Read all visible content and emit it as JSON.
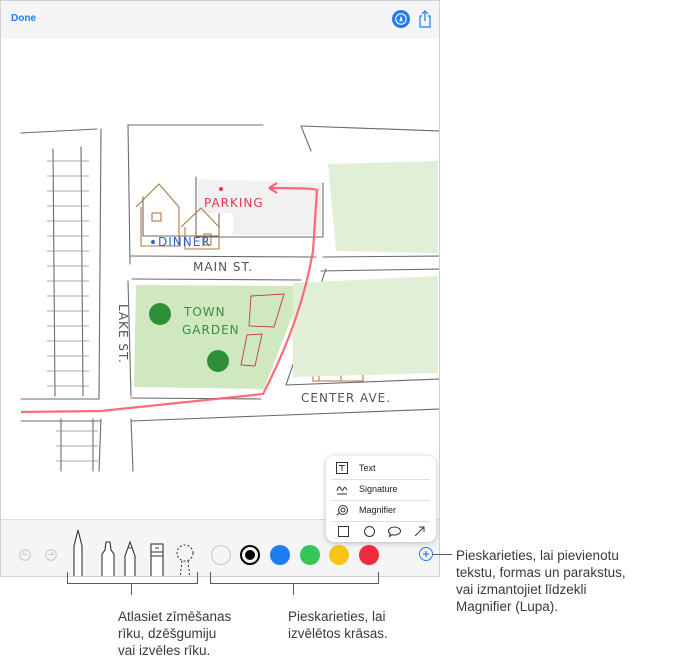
{
  "topbar": {
    "done_label": "Done",
    "markup_icon": "markup-pen-icon",
    "share_icon": "share-icon"
  },
  "map": {
    "labels": {
      "parking": "PARKING",
      "dinner": "DINNER",
      "main_st": "MAIN ST.",
      "town": "TOWN",
      "garden": "GARDEN",
      "lake_st": "LAKE ST.",
      "center_ave": "CENTER AVE."
    },
    "colors": {
      "route": "#ff5b6e",
      "parking_text": "#e23a4a",
      "dinner_text": "#2d63d6",
      "garden_fill": "#cfe8c0",
      "house_stroke": "#b27643"
    }
  },
  "popup": {
    "items": [
      {
        "label": "Text",
        "icon": "text-box-icon"
      },
      {
        "label": "Signature",
        "icon": "signature-icon"
      },
      {
        "label": "Magnifier",
        "icon": "magnifier-icon"
      }
    ],
    "shapes": [
      "square-shape-icon",
      "circle-shape-icon",
      "speech-bubble-shape-icon",
      "arrow-shape-icon"
    ]
  },
  "toolbar": {
    "undo_icon": "undo-icon",
    "redo_icon": "redo-icon",
    "tools": [
      "pen-tool",
      "marker-tool",
      "pencil-tool",
      "eraser-tool",
      "lasso-tool"
    ],
    "colors": [
      {
        "name": "white",
        "hex": "#ffffff"
      },
      {
        "name": "black",
        "hex": "#000000"
      },
      {
        "name": "blue",
        "hex": "#1c7cf0"
      },
      {
        "name": "green",
        "hex": "#34c759"
      },
      {
        "name": "yellow",
        "hex": "#f5c518"
      },
      {
        "name": "red",
        "hex": "#ef2b40"
      }
    ],
    "selected_color": "black",
    "add_icon": "add-circle-icon"
  },
  "callouts": {
    "right": [
      "Pieskarieties, lai pievienotu",
      "tekstu, formas un parakstus,",
      "vai izmantojiet līdzekli",
      "Magnifier (Lupa)."
    ],
    "left": [
      "Atlasiet zīmēšanas",
      "rīku, dzēšgumiju",
      "vai izvēles rīku."
    ],
    "middle": [
      "Pieskarieties, lai",
      "izvēlētos krāsas."
    ]
  }
}
